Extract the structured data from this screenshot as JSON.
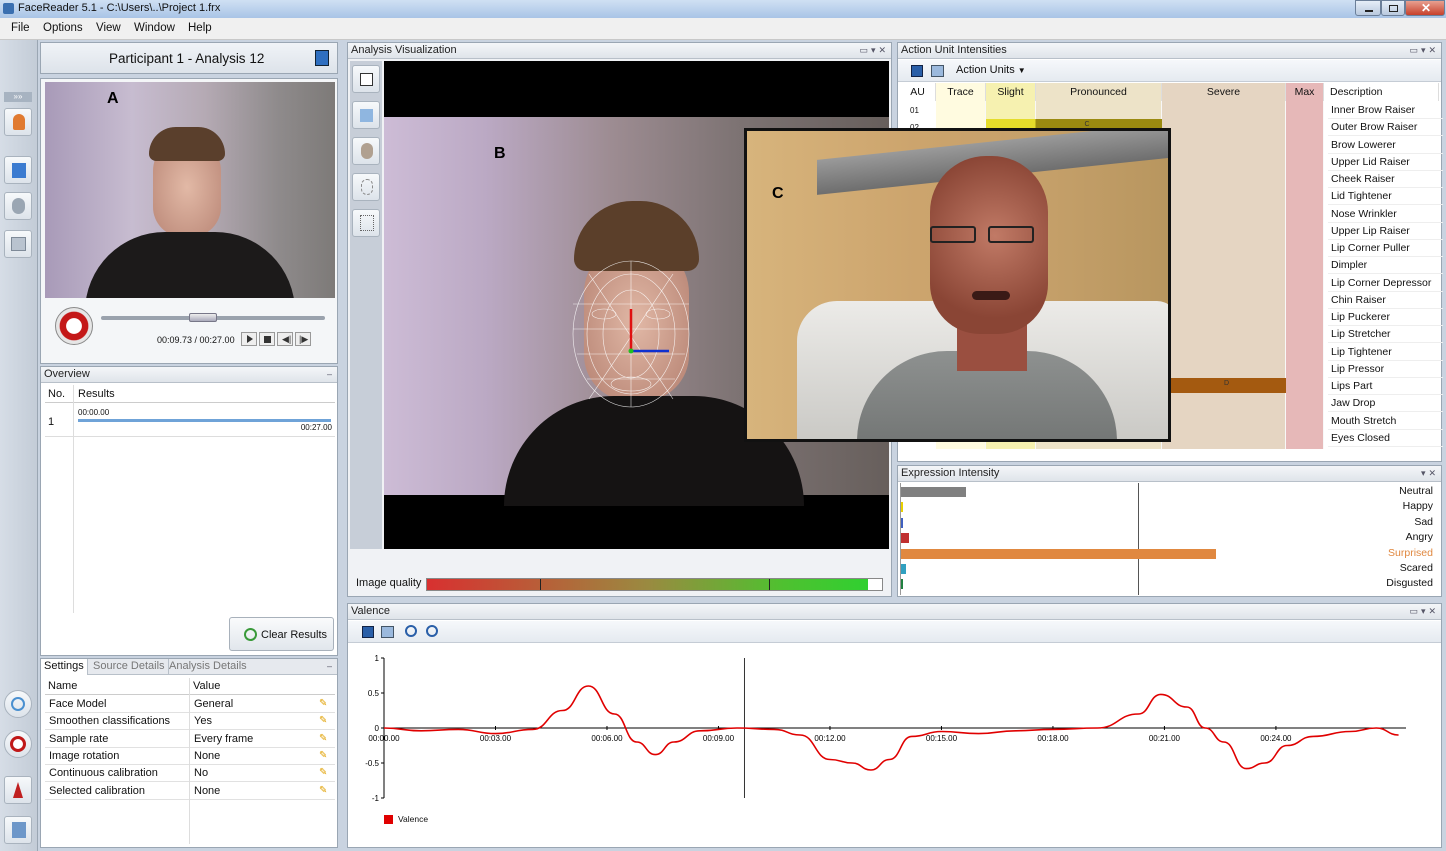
{
  "window": {
    "title": "FaceReader 5.1 - C:\\Users\\..\\Project 1.frx"
  },
  "menu": [
    "File",
    "Options",
    "View",
    "Window",
    "Help"
  ],
  "participant": {
    "title": "Participant 1 - Analysis 12"
  },
  "video": {
    "time": "00:09.73 / 00:27.00",
    "progress": 0.45,
    "label_a": "A"
  },
  "overview": {
    "title": "Overview",
    "col_no": "No.",
    "col_results": "Results",
    "row": {
      "no": "1",
      "start": "00:00.00",
      "end": "00:27.00"
    },
    "clear_button": "Clear Results"
  },
  "settings": {
    "tabs": [
      "Settings",
      "Source Details",
      "Analysis Details"
    ],
    "col_name": "Name",
    "col_value": "Value",
    "rows": [
      {
        "name": "Face Model",
        "value": "General"
      },
      {
        "name": "Smoothen classifications",
        "value": "Yes"
      },
      {
        "name": "Sample rate",
        "value": "Every frame"
      },
      {
        "name": "Image rotation",
        "value": "None"
      },
      {
        "name": "Continuous calibration",
        "value": "No"
      },
      {
        "name": "Selected calibration",
        "value": "None"
      }
    ]
  },
  "analysis": {
    "title": "Analysis Visualization",
    "label_b": "B",
    "label_c": "C",
    "image_quality_label": "Image quality",
    "image_quality": 0.97
  },
  "action_units": {
    "title": "Action Unit Intensities",
    "toolbar_label": "Action Units",
    "headers": [
      "AU",
      "Trace",
      "Slight",
      "Pronounced",
      "Severe",
      "Max",
      "Description"
    ],
    "visible_au": [
      "01",
      "02"
    ],
    "marks": [
      {
        "row": 1,
        "letter": "C"
      },
      {
        "row": 16,
        "letter": "D"
      }
    ],
    "descriptions": [
      "Inner Brow Raiser",
      "Outer Brow Raiser",
      "Brow Lowerer",
      "Upper Lid Raiser",
      "Cheek Raiser",
      "Lid Tightener",
      "Nose Wrinkler",
      "Upper Lip Raiser",
      "Lip Corner Puller",
      "Dimpler",
      "Lip Corner Depressor",
      "Chin Raiser",
      "Lip Puckerer",
      "Lip Stretcher",
      "Lip Tightener",
      "Lip Pressor",
      "Lips Part",
      "Jaw Drop",
      "Mouth Stretch",
      "Eyes Closed"
    ]
  },
  "expression": {
    "title": "Expression Intensity",
    "items": [
      {
        "name": "Neutral",
        "value": 0.13,
        "color": "#808080"
      },
      {
        "name": "Happy",
        "value": 0.0,
        "color": "#e8d000"
      },
      {
        "name": "Sad",
        "value": 0.0,
        "color": "#4060c0"
      },
      {
        "name": "Angry",
        "value": 0.015,
        "color": "#c03030"
      },
      {
        "name": "Surprised",
        "value": 0.63,
        "color": "#e08840"
      },
      {
        "name": "Scared",
        "value": 0.01,
        "color": "#30a0c0"
      },
      {
        "name": "Disgusted",
        "value": 0.0,
        "color": "#208040"
      }
    ],
    "highlight_color": "#e08840"
  },
  "valence": {
    "title": "Valence",
    "legend": "Valence",
    "color": "#e00000",
    "yticks": [
      "1",
      "0.5",
      "0",
      "-0.5",
      "-1"
    ],
    "xticks": [
      "00:00.00",
      "00:03.00",
      "00:06.00",
      "00:09.00",
      "00:12.00",
      "00:15.00",
      "00:18.00",
      "00:21.00",
      "00:24.00"
    ],
    "cursor_time_s": 9.7,
    "points": [
      [
        0,
        0
      ],
      [
        1,
        -0.04
      ],
      [
        2,
        -0.02
      ],
      [
        3,
        -0.08
      ],
      [
        4,
        -0.02
      ],
      [
        4.8,
        0.25
      ],
      [
        5.5,
        0.6
      ],
      [
        6.2,
        0.2
      ],
      [
        6.8,
        -0.2
      ],
      [
        7.3,
        -0.38
      ],
      [
        7.8,
        -0.2
      ],
      [
        8.5,
        -0.04
      ],
      [
        9.5,
        0
      ],
      [
        10.5,
        -0.02
      ],
      [
        11.2,
        -0.1
      ],
      [
        12,
        -0.45
      ],
      [
        12.6,
        -0.5
      ],
      [
        13.1,
        -0.6
      ],
      [
        13.6,
        -0.45
      ],
      [
        14.2,
        -0.12
      ],
      [
        15,
        -0.05
      ],
      [
        16,
        -0.08
      ],
      [
        17,
        -0.04
      ],
      [
        18,
        -0.02
      ],
      [
        19.2,
        0
      ],
      [
        20.3,
        0.2
      ],
      [
        20.9,
        0.48
      ],
      [
        21.6,
        0.3
      ],
      [
        22.1,
        0
      ],
      [
        22.6,
        -0.2
      ],
      [
        23.2,
        -0.58
      ],
      [
        23.7,
        -0.5
      ],
      [
        24.3,
        -0.25
      ],
      [
        25,
        -0.12
      ],
      [
        26,
        -0.05
      ],
      [
        26.7,
        0
      ],
      [
        27.3,
        -0.1
      ]
    ],
    "xmax": 27.5
  }
}
